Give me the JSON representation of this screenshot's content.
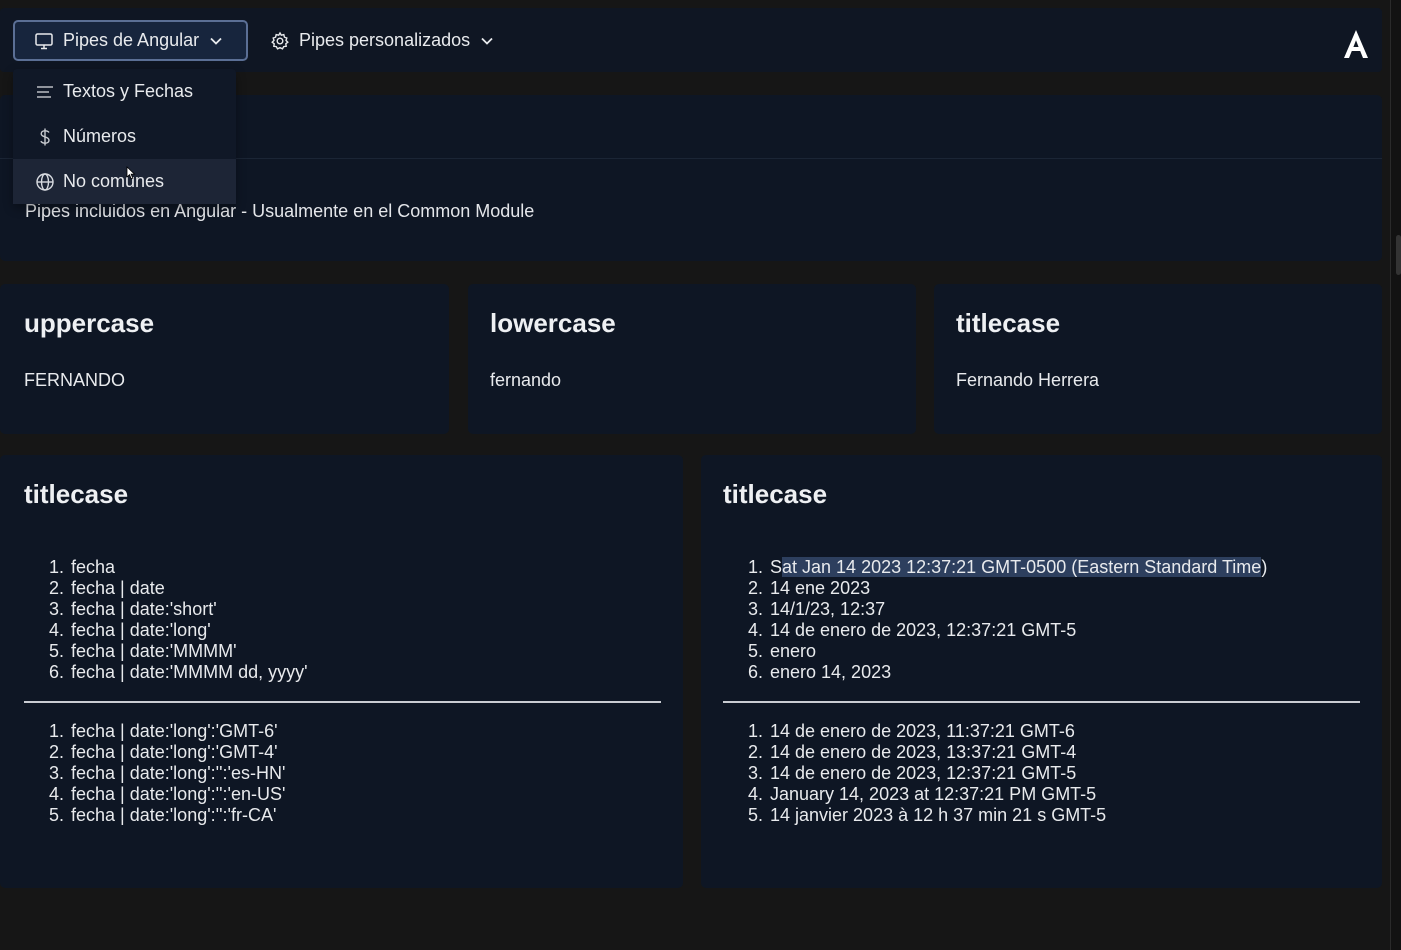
{
  "nav": {
    "menu1_label": "Pipes de Angular",
    "menu2_label": "Pipes personalizados",
    "brand_letter": "A",
    "dropdown": [
      {
        "label": "Textos y Fechas",
        "icon": "align-left-icon"
      },
      {
        "label": "Números",
        "icon": "dollar-icon"
      },
      {
        "label": "No comunes",
        "icon": "globe-icon"
      }
    ]
  },
  "header": {
    "subtitle": "Pipes incluidos en Angular - Usualmente en el Common Module"
  },
  "cards": {
    "uppercase": {
      "title": "uppercase",
      "value": "FERNANDO"
    },
    "lowercase": {
      "title": "lowercase",
      "value": "fernando"
    },
    "titlecase": {
      "title": "titlecase",
      "value": "Fernando Herrera"
    },
    "left": {
      "title": "titlecase",
      "list1": [
        "fecha",
        "fecha | date",
        "fecha | date:'short'",
        "fecha | date:'long'",
        "fecha | date:'MMMM'",
        "fecha | date:'MMMM dd, yyyy'"
      ],
      "list2": [
        "fecha | date:'long':'GMT-6'",
        "fecha | date:'long':'GMT-4'",
        "fecha | date:'long':'':'es-HN'",
        "fecha | date:'long':'':'en-US'",
        "fecha | date:'long':'':'fr-CA'"
      ]
    },
    "right": {
      "title": "titlecase",
      "list1": [
        "Sat Jan 14 2023 12:37:21 GMT-0500 (Eastern Standard Time)",
        "14 ene 2023",
        "14/1/23, 12:37",
        "14 de enero de 2023, 12:37:21 GMT-5",
        "enero",
        "enero 14, 2023"
      ],
      "list2": [
        "14 de enero de 2023, 11:37:21 GMT-6",
        "14 de enero de 2023, 13:37:21 GMT-4",
        "14 de enero de 2023, 12:37:21 GMT-5",
        "January 14, 2023 at 12:37:21 PM GMT-5",
        "14 janvier 2023 à 12 h 37 min 21 s GMT-5"
      ]
    }
  },
  "colors": {
    "background": "#161616",
    "card": "#0e1624",
    "active_menu_border": "#5b6f95",
    "selection": "#2d3f5e"
  }
}
